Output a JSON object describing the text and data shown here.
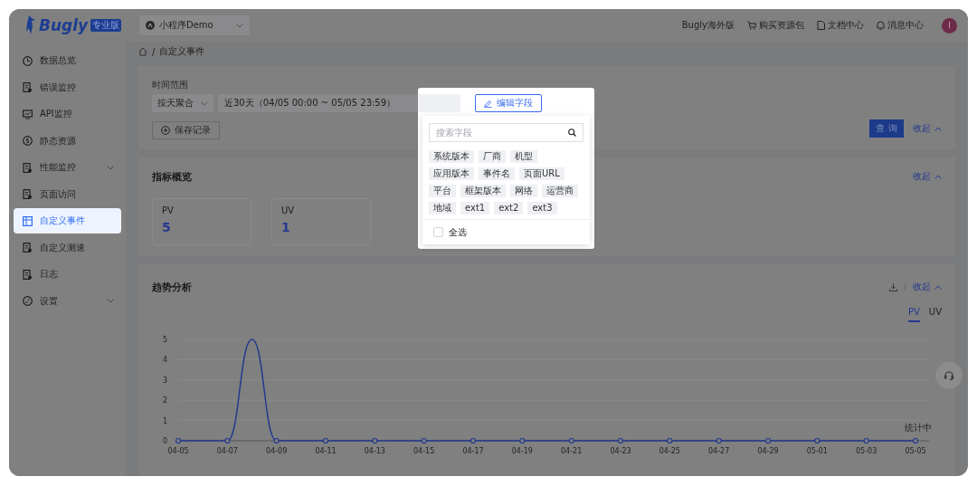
{
  "header": {
    "logo": "Bugly",
    "edition_badge": "专业版",
    "project": "小程序Demo",
    "links": [
      {
        "kind": "plain",
        "label": "Bugly海外版"
      },
      {
        "kind": "cart",
        "label": "购买资源包"
      },
      {
        "kind": "doc",
        "label": "文档中心"
      },
      {
        "kind": "bell",
        "label": "消息中心"
      }
    ],
    "avatar": "I"
  },
  "sidebar": {
    "items": [
      {
        "label": "数据总览",
        "kind": "link",
        "selected": false
      },
      {
        "label": "错误监控",
        "kind": "link",
        "selected": false
      },
      {
        "label": "API监控",
        "kind": "link",
        "selected": false
      },
      {
        "label": "静态资源",
        "kind": "link",
        "selected": false
      },
      {
        "label": "性能监控",
        "kind": "group",
        "selected": false
      },
      {
        "label": "页面访问",
        "kind": "link",
        "selected": false
      },
      {
        "label": "自定义事件",
        "kind": "link",
        "selected": true
      },
      {
        "label": "自定义测速",
        "kind": "link",
        "selected": false
      },
      {
        "label": "日志",
        "kind": "link",
        "selected": false
      },
      {
        "label": "设置",
        "kind": "group",
        "selected": false
      }
    ]
  },
  "breadcrumb": {
    "separator": "/",
    "current": "自定义事件"
  },
  "filter": {
    "label": "时间范围",
    "aggregation": "按天聚合",
    "date_range": "近30天（04/05 00:00 ~ 05/05 23:59）",
    "save_button": "保存记录",
    "query_button": "查 询",
    "collapse": "收起"
  },
  "metrics": {
    "title": "指标概览",
    "collapse": "收起",
    "cards": [
      {
        "label": "PV",
        "value": "5"
      },
      {
        "label": "UV",
        "value": "1"
      }
    ]
  },
  "trend": {
    "title": "趋势分析",
    "collapse": "收起",
    "tabs": [
      {
        "label": "PV",
        "selected": true
      },
      {
        "label": "UV",
        "selected": false
      }
    ],
    "status": "统计中",
    "chart_data": {
      "type": "line",
      "grid": true,
      "categories": [
        "04-05",
        null,
        "04-07",
        null,
        "04-09",
        null,
        "04-11",
        null,
        "04-13",
        null,
        "04-15",
        null,
        "04-17",
        null,
        "04-19",
        null,
        "04-21",
        null,
        "04-23",
        null,
        "04-25",
        null,
        "04-27",
        null,
        "04-29",
        null,
        "05-01",
        null,
        "05-03",
        null,
        "05-05"
      ],
      "series": [
        {
          "color": "#24398f",
          "values": [
            0,
            0,
            0,
            5,
            0,
            0,
            0,
            0,
            0,
            0,
            0,
            0,
            0,
            0,
            0,
            0,
            0,
            0,
            0,
            0,
            0,
            0,
            0,
            0,
            0,
            0,
            0,
            0,
            0,
            0,
            0
          ]
        }
      ],
      "ylim": [
        0,
        5
      ],
      "yticks": [
        0,
        1,
        2,
        3,
        4,
        5
      ]
    }
  },
  "field_popover": {
    "edit_button": "编辑字段",
    "search_placeholder": "搜索字段",
    "tags": [
      "系统版本",
      "厂商",
      "机型",
      "应用版本",
      "事件名",
      "页面URL",
      "平台",
      "框架版本",
      "网络",
      "运营商",
      "地域",
      "ext1",
      "ext2",
      "ext3"
    ],
    "select_all": {
      "label": "全选",
      "checked": false
    }
  }
}
